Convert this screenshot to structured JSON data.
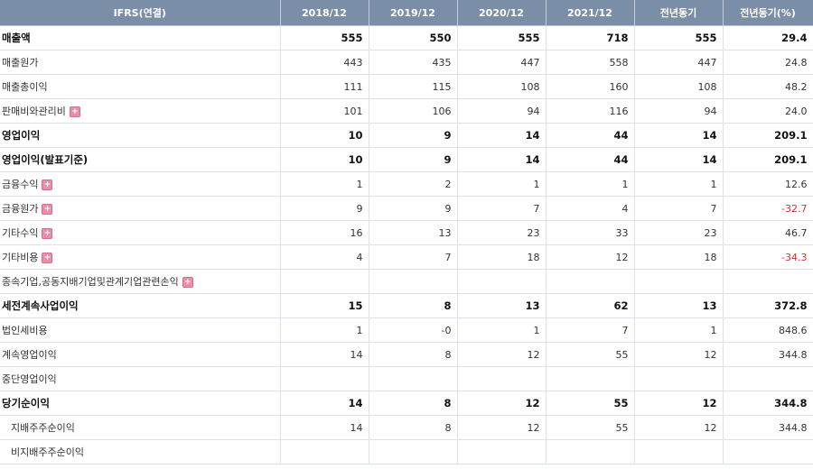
{
  "header": [
    "IFRS(연결)",
    "2018/12",
    "2019/12",
    "2020/12",
    "2021/12",
    "전년동기",
    "전년동기(%)"
  ],
  "rows": [
    {
      "label": "매출액",
      "bold": true,
      "expand": false,
      "indent": false,
      "values": [
        "555",
        "550",
        "555",
        "718",
        "555",
        "29.4"
      ]
    },
    {
      "label": "매출원가",
      "bold": false,
      "expand": false,
      "indent": false,
      "values": [
        "443",
        "435",
        "447",
        "558",
        "447",
        "24.8"
      ]
    },
    {
      "label": "매출총이익",
      "bold": false,
      "expand": false,
      "indent": false,
      "values": [
        "111",
        "115",
        "108",
        "160",
        "108",
        "48.2"
      ]
    },
    {
      "label": "판매비와관리비",
      "bold": false,
      "expand": true,
      "indent": false,
      "values": [
        "101",
        "106",
        "94",
        "116",
        "94",
        "24.0"
      ]
    },
    {
      "label": "영업이익",
      "bold": true,
      "expand": false,
      "indent": false,
      "values": [
        "10",
        "9",
        "14",
        "44",
        "14",
        "209.1"
      ]
    },
    {
      "label": "영업이익(발표기준)",
      "bold": true,
      "expand": false,
      "indent": false,
      "values": [
        "10",
        "9",
        "14",
        "44",
        "14",
        "209.1"
      ]
    },
    {
      "label": "금융수익",
      "bold": false,
      "expand": true,
      "indent": false,
      "values": [
        "1",
        "2",
        "1",
        "1",
        "1",
        "12.6"
      ]
    },
    {
      "label": "금융원가",
      "bold": false,
      "expand": true,
      "indent": false,
      "values": [
        "9",
        "9",
        "7",
        "4",
        "7",
        "-32.7"
      ]
    },
    {
      "label": "기타수익",
      "bold": false,
      "expand": true,
      "indent": false,
      "values": [
        "16",
        "13",
        "23",
        "33",
        "23",
        "46.7"
      ]
    },
    {
      "label": "기타비용",
      "bold": false,
      "expand": true,
      "indent": false,
      "values": [
        "4",
        "7",
        "18",
        "12",
        "18",
        "-34.3"
      ]
    },
    {
      "label": "종속기업,공동지배기업및관계기업관련손익",
      "bold": false,
      "expand": true,
      "indent": false,
      "values": [
        "",
        "",
        "",
        "",
        "",
        ""
      ]
    },
    {
      "label": "세전계속사업이익",
      "bold": true,
      "expand": false,
      "indent": false,
      "values": [
        "15",
        "8",
        "13",
        "62",
        "13",
        "372.8"
      ]
    },
    {
      "label": "법인세비용",
      "bold": false,
      "expand": false,
      "indent": false,
      "values": [
        "1",
        "-0",
        "1",
        "7",
        "1",
        "848.6"
      ]
    },
    {
      "label": "계속영업이익",
      "bold": false,
      "expand": false,
      "indent": false,
      "values": [
        "14",
        "8",
        "12",
        "55",
        "12",
        "344.8"
      ]
    },
    {
      "label": "중단영업이익",
      "bold": false,
      "expand": false,
      "indent": false,
      "values": [
        "",
        "",
        "",
        "",
        "",
        ""
      ]
    },
    {
      "label": "당기순이익",
      "bold": true,
      "expand": false,
      "indent": false,
      "values": [
        "14",
        "8",
        "12",
        "55",
        "12",
        "344.8"
      ]
    },
    {
      "label": "지배주주순이익",
      "bold": false,
      "expand": false,
      "indent": true,
      "values": [
        "14",
        "8",
        "12",
        "55",
        "12",
        "344.8"
      ]
    },
    {
      "label": "비지배주주순이익",
      "bold": false,
      "expand": false,
      "indent": true,
      "values": [
        "",
        "",
        "",
        "",
        "",
        ""
      ]
    }
  ],
  "expand_symbol": "+",
  "colors": {
    "header_bg": "#7b8ea8",
    "negative": "#d0312d",
    "expand_icon": "#ea8fa7"
  }
}
